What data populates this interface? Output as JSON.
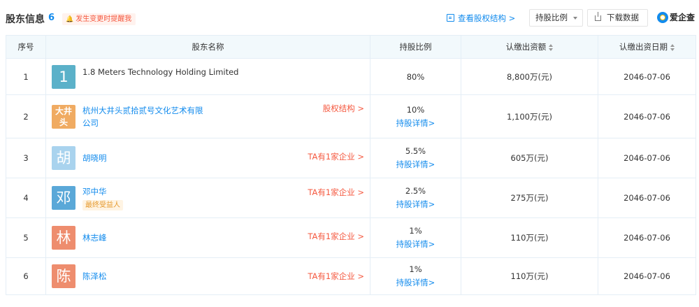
{
  "header": {
    "title": "股东信息",
    "count": "6",
    "alert_label": "发生变更时提醒我",
    "structure_link": "查看股权结构 >",
    "sort_select": "持股比例",
    "download_label": "下载数据",
    "brand": "爱企查"
  },
  "table": {
    "columns": [
      "序号",
      "股东名称",
      "持股比例",
      "认缴出资额",
      "认缴出资日期"
    ],
    "rows": [
      {
        "idx": "1",
        "avatar": "1",
        "avatar_color": "#5bb1c9",
        "name_lines": [
          "1.8 Meters Technology Holding Limited"
        ],
        "name_style": "plain",
        "badge": "",
        "right_link": "",
        "ratio": "80%",
        "detail": "",
        "amount": "8,800万(元)",
        "date": "2046-07-06"
      },
      {
        "idx": "2",
        "avatar": "大井头",
        "avatar_color": "#f0ab62",
        "name_lines": [
          "杭州大井头贰拾贰号文化艺术有限",
          "公司"
        ],
        "name_style": "link",
        "badge": "",
        "right_link": "股权结构 >",
        "ratio": "10%",
        "detail": "持股详情>",
        "amount": "1,100万(元)",
        "date": "2046-07-06"
      },
      {
        "idx": "3",
        "avatar": "胡",
        "avatar_color": "#a9d3ee",
        "name_lines": [
          "胡晓明"
        ],
        "name_style": "link",
        "badge": "",
        "right_link": "TA有1家企业 >",
        "ratio": "5.5%",
        "detail": "持股详情>",
        "amount": "605万(元)",
        "date": "2046-07-06"
      },
      {
        "idx": "4",
        "avatar": "邓",
        "avatar_color": "#5aa8d8",
        "name_lines": [
          "邓中华"
        ],
        "name_style": "link",
        "badge": "最终受益人",
        "right_link": "TA有1家企业 >",
        "ratio": "2.5%",
        "detail": "持股详情>",
        "amount": "275万(元)",
        "date": "2046-07-06"
      },
      {
        "idx": "5",
        "avatar": "林",
        "avatar_color": "#ee8d6e",
        "name_lines": [
          "林志峰"
        ],
        "name_style": "link",
        "badge": "",
        "right_link": "TA有1家企业 >",
        "ratio": "1%",
        "detail": "持股详情>",
        "amount": "110万(元)",
        "date": "2046-07-06"
      },
      {
        "idx": "6",
        "avatar": "陈",
        "avatar_color": "#ee8d6e",
        "name_lines": [
          "陈泽松"
        ],
        "name_style": "link",
        "badge": "",
        "right_link": "TA有1家企业 >",
        "ratio": "1%",
        "detail": "持股详情>",
        "amount": "110万(元)",
        "date": "2046-07-06"
      }
    ]
  }
}
